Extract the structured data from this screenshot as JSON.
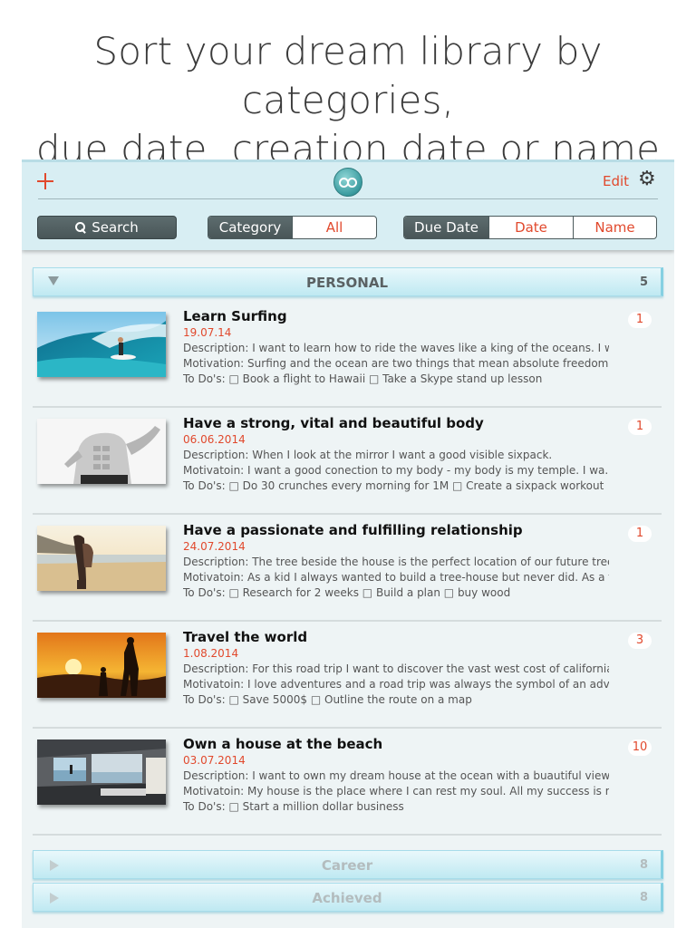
{
  "headline": {
    "line1": "Sort your dream library by categories,",
    "line2": "due date, creation date or name"
  },
  "toolbar": {
    "add_icon": "plus-icon",
    "logo_icon": "app-logo-icon",
    "edit_label": "Edit",
    "settings_icon": "gear-icon",
    "search_label": "Search",
    "category_label": "Category",
    "all_label": "All",
    "sort_options": [
      "Due Date",
      "Date",
      "Name"
    ],
    "selected_sort": "Due Date"
  },
  "colors": {
    "accent": "#e1492d",
    "toolbar_bg": "#d8eef3",
    "segment_selected": "#4f5d5f"
  },
  "sections": [
    {
      "name": "PERSONAL",
      "count": "5",
      "expanded": true
    },
    {
      "name": "Career",
      "count": "8",
      "expanded": false
    },
    {
      "name": "Achieved",
      "count": "8",
      "expanded": false
    }
  ],
  "items": [
    {
      "title": "Learn Surfing",
      "date": "19.07.14",
      "description": "Description: I want to learn how to ride the waves like a king of the oceans. I wa...",
      "motivation": "Motivation: Surfing and the ocean are two things that mean absolute freedom to...",
      "todos": "To Do's: □ Book a flight to Hawaii □ Take a Skype stand up lesson",
      "badge": "1",
      "image": "surfer-wave-photo"
    },
    {
      "title": "Have a strong, vital and beautiful body",
      "date": "06.06.2014",
      "description": "Description: When I look at the mirror I want a good visible sixpack.",
      "motivation": "Motivatoin: I want a good conection to my body - my body is my temple. I wa...",
      "todos": "To Do's: □ Do 30 crunches every morning for 1M □ Create a sixpack workout",
      "badge": "1",
      "image": "fit-torso-photo"
    },
    {
      "title": "Have a passionate and fulfilling relationship",
      "date": "24.07.2014",
      "description": "Description: The tree beside the house is the perfect location of our future tree-...",
      "motivation": "Motivatoin: As a kid I always wanted to build a tree-house but never did. As a f...",
      "todos": "To Do's: □ Research for 2 weeks □ Build a plan □ buy wood",
      "badge": "1",
      "image": "couple-beach-photo"
    },
    {
      "title": "Travel the world",
      "date": "1.08.2014",
      "description": "Description: For this road trip I want to discover the vast west cost of california...",
      "motivation": "Motivatoin: I love adventures and a road trip was always the symbol of an adve...",
      "todos": "To Do's: □ Save 5000$ □ Outline the route on a map",
      "badge": "3",
      "image": "sunset-hikers-photo"
    },
    {
      "title": "Own a house at the beach",
      "date": "03.07.2014",
      "description": "Description: I want to own my dream house at the ocean with a buautiful view...",
      "motivation": "Motivatoin: My house is the place where I can rest my soul. All my success is m...",
      "todos": "To Do's: □ Start a million dollar business",
      "badge": "10",
      "image": "beach-house-photo"
    }
  ]
}
